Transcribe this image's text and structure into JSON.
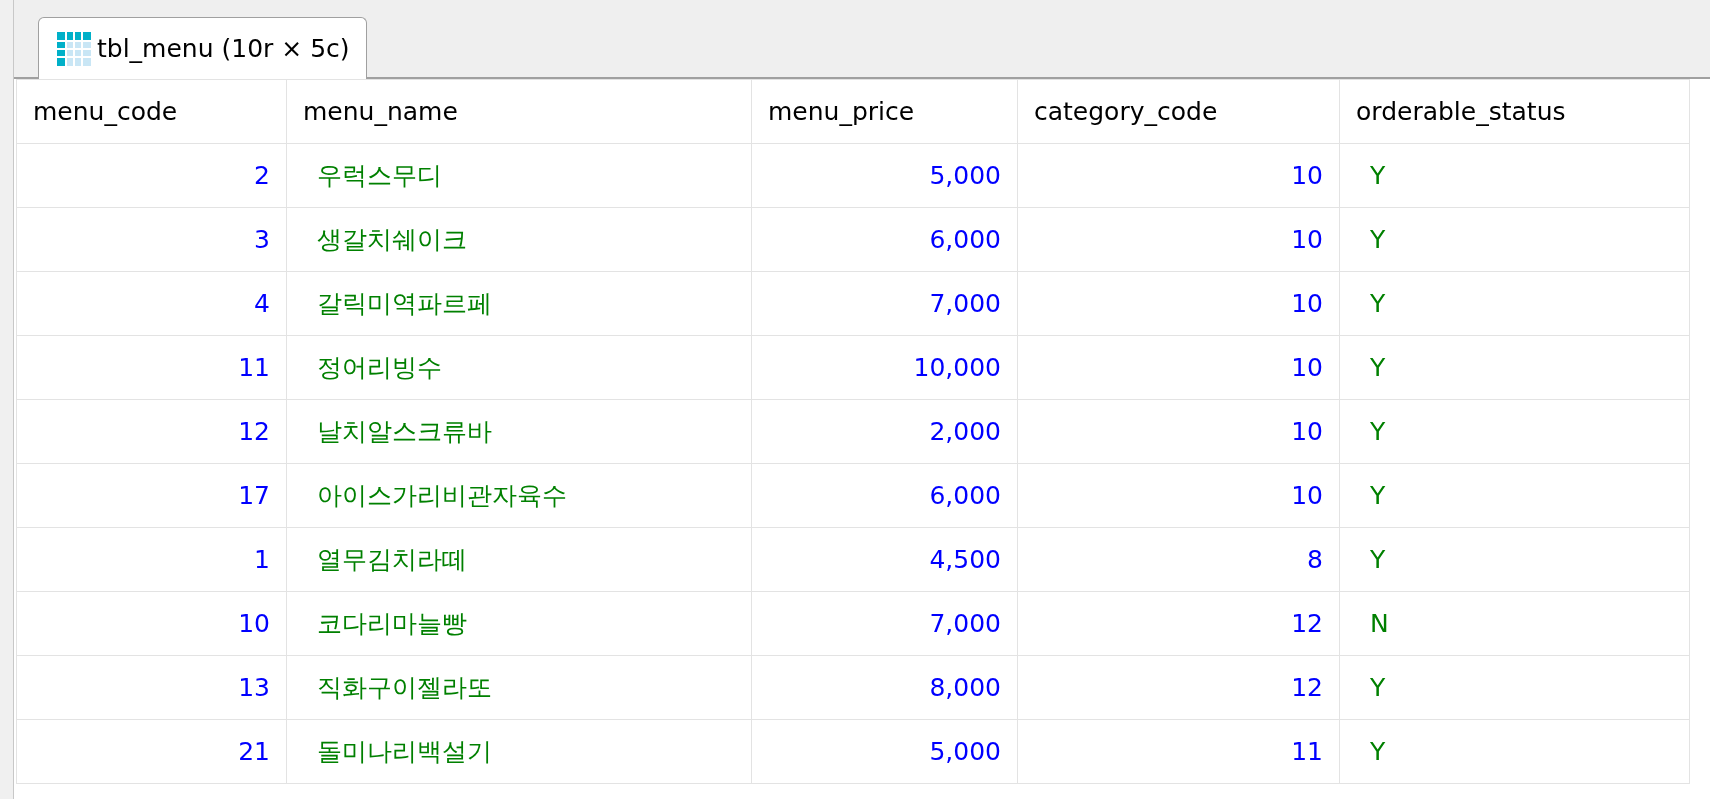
{
  "tab": {
    "label": "tbl_menu (10r × 5c)"
  },
  "table": {
    "columns": [
      {
        "label": "menu_code",
        "kind": "number"
      },
      {
        "label": "menu_name",
        "kind": "text"
      },
      {
        "label": "menu_price",
        "kind": "number"
      },
      {
        "label": "category_code",
        "kind": "number"
      },
      {
        "label": "orderable_status",
        "kind": "text"
      }
    ],
    "rows": [
      [
        "2",
        "우럭스무디",
        "5,000",
        "10",
        "Y"
      ],
      [
        "3",
        "생갈치쉐이크",
        "6,000",
        "10",
        "Y"
      ],
      [
        "4",
        "갈릭미역파르페",
        "7,000",
        "10",
        "Y"
      ],
      [
        "11",
        "정어리빙수",
        "10,000",
        "10",
        "Y"
      ],
      [
        "12",
        "날치알스크류바",
        "2,000",
        "10",
        "Y"
      ],
      [
        "17",
        "아이스가리비관자육수",
        "6,000",
        "10",
        "Y"
      ],
      [
        "1",
        "열무김치라떼",
        "4,500",
        "8",
        "Y"
      ],
      [
        "10",
        "코다리마늘빵",
        "7,000",
        "12",
        "N"
      ],
      [
        "13",
        "직화구이젤라또",
        "8,000",
        "12",
        "Y"
      ],
      [
        "21",
        "돌미나리백설기",
        "5,000",
        "11",
        "Y"
      ]
    ]
  }
}
